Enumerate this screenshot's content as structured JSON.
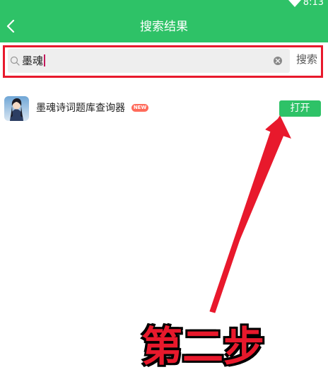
{
  "status": {
    "time": "8:13"
  },
  "header": {
    "title": "搜索结果"
  },
  "search": {
    "value": "墨魂",
    "submit_label": "搜索"
  },
  "results": [
    {
      "name": "墨魂诗词题库查询器",
      "badge": "NEW",
      "action_label": "打开"
    }
  ],
  "annotation": {
    "label": "第二步"
  },
  "colors": {
    "brand": "#2ec267",
    "highlight": "#e8192c"
  }
}
